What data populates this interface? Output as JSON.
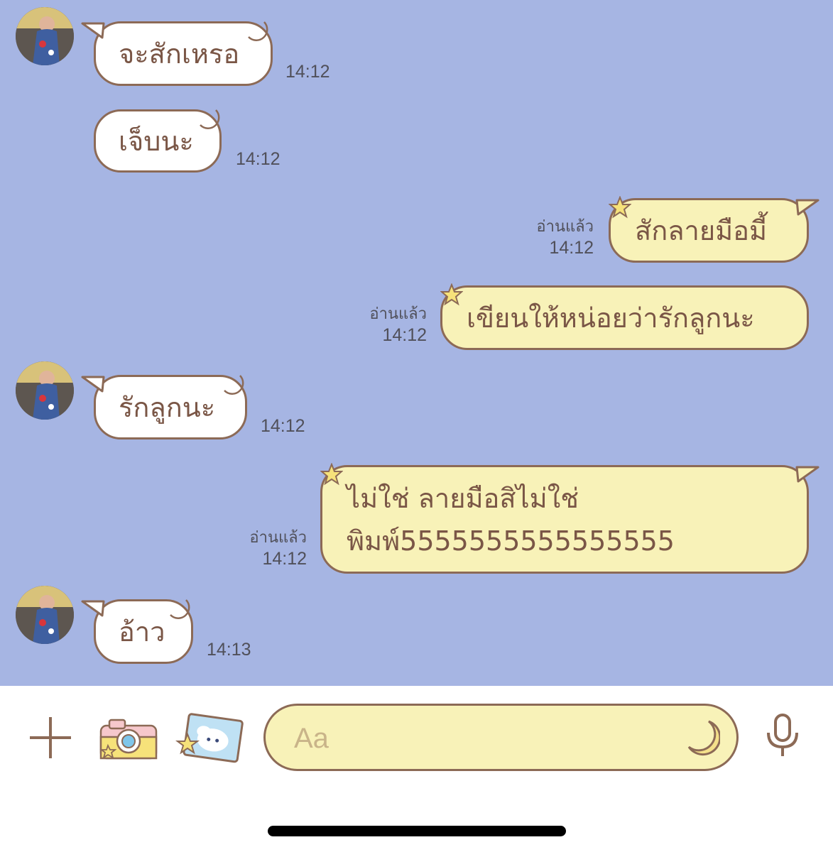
{
  "colors": {
    "chat_background": "#a6b5e3",
    "incoming_bubble": "#ffffff",
    "outgoing_bubble": "#f8f2b8",
    "bubble_border": "#8c6a56",
    "bubble_text": "#7a5646"
  },
  "messages": [
    {
      "direction": "incoming",
      "text": "จะสักเหรอ",
      "time": "14:12"
    },
    {
      "direction": "incoming",
      "text": "เจ็บนะ",
      "time": "14:12"
    },
    {
      "direction": "outgoing",
      "text": "สักลายมือมี้",
      "read": "อ่านแล้ว",
      "time": "14:12"
    },
    {
      "direction": "outgoing",
      "text": "เขียนให้หน่อยว่ารักลูกนะ",
      "read": "อ่านแล้ว",
      "time": "14:12"
    },
    {
      "direction": "incoming",
      "text": "รักลูกนะ",
      "time": "14:12"
    },
    {
      "direction": "outgoing",
      "line1": "ไม่ใช่ ลายมือสิไม่ใช่",
      "line2": "พิมพ์5555555555555555",
      "read": "อ่านแล้ว",
      "time": "14:12"
    },
    {
      "direction": "incoming",
      "text": "อ้าว",
      "time": "14:13"
    }
  ],
  "composer": {
    "placeholder": "Aa",
    "icons": [
      "plus-icon",
      "camera-icon",
      "photo-icon",
      "moon-sticker-icon",
      "microphone-icon"
    ]
  }
}
